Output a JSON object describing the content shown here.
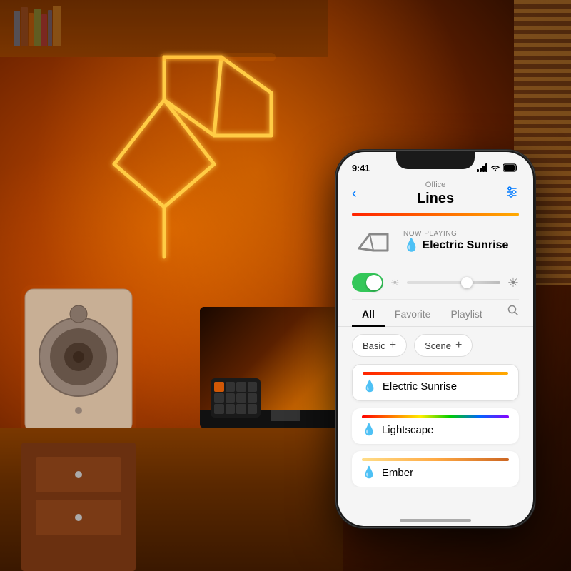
{
  "background": {
    "description": "Office room with warm orange ambient lighting"
  },
  "phone": {
    "status_bar": {
      "time": "9:41",
      "signal": "●●●",
      "wifi": "wifi",
      "battery": "battery"
    },
    "header": {
      "back_icon": "‹",
      "subtitle": "Office",
      "title": "Lines",
      "settings_icon": "settings"
    },
    "device": {
      "now_playing_label": "Now Playing",
      "scene_name": "Electric Sunrise",
      "drop_icon": "💧"
    },
    "color_bar_electric_sunrise": "linear-gradient(to right, #ff2200, #ff6600, #ffaa00)",
    "controls": {
      "toggle_on": true,
      "brightness_pct": 60
    },
    "tabs": [
      {
        "label": "All",
        "active": true
      },
      {
        "label": "Favorite",
        "active": false
      },
      {
        "label": "Playlist",
        "active": false
      }
    ],
    "categories": [
      {
        "label": "Basic",
        "plus": "+"
      },
      {
        "label": "Scene",
        "plus": "+"
      }
    ],
    "scenes": [
      {
        "name": "Electric Sunrise",
        "color_bar": "linear-gradient(to right, #ff2200, #ff6600, #ffaa00)",
        "active": true
      },
      {
        "name": "Lightscape",
        "color_bar": "linear-gradient(to right, #ff0000, #ff7700, #ffee00, #00cc00, #0066ff, #8800ff)",
        "active": false
      },
      {
        "name": "Ember",
        "color_bar": "linear-gradient(to right, #ffdd88, #ffaa44, #cc6622)",
        "active": false
      }
    ]
  }
}
